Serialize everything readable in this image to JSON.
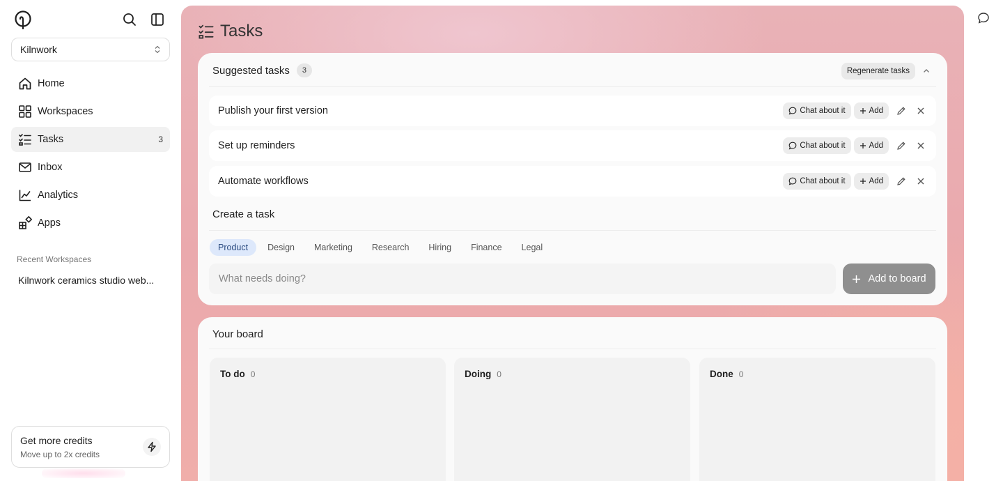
{
  "sidebar": {
    "workspace_name": "Kilnwork",
    "nav": [
      {
        "label": "Home",
        "icon": "home-icon"
      },
      {
        "label": "Workspaces",
        "icon": "grid-icon"
      },
      {
        "label": "Tasks",
        "icon": "tasks-icon",
        "count": "3",
        "active": true
      },
      {
        "label": "Inbox",
        "icon": "mail-icon"
      },
      {
        "label": "Analytics",
        "icon": "chart-icon"
      },
      {
        "label": "Apps",
        "icon": "apps-icon"
      }
    ],
    "recent_label": "Recent Workspaces",
    "recent_items": [
      "Kilnwork ceramics studio web..."
    ],
    "credits": {
      "title": "Get more credits",
      "subtitle": "Move up to 2x credits"
    }
  },
  "page": {
    "title": "Tasks"
  },
  "suggested": {
    "title": "Suggested tasks",
    "count": "3",
    "regenerate_label": "Regenerate tasks",
    "chat_label": "Chat about it",
    "add_label": "Add",
    "tasks": [
      "Publish your first version",
      "Set up reminders",
      "Automate workflows"
    ]
  },
  "create": {
    "title": "Create a task",
    "categories": [
      "Product",
      "Design",
      "Marketing",
      "Research",
      "Hiring",
      "Finance",
      "Legal"
    ],
    "active_category": "Product",
    "placeholder": "What needs doing?",
    "submit_label": "Add to board"
  },
  "board": {
    "title": "Your board",
    "columns": [
      {
        "name": "To do",
        "count": "0"
      },
      {
        "name": "Doing",
        "count": "0"
      },
      {
        "name": "Done",
        "count": "0"
      }
    ]
  },
  "colors": {
    "accent_pill": "#dde8fb",
    "submit_button": "#8f8f8f",
    "main_gradient_start": "#e9b2b7",
    "main_gradient_end": "#f0aeaa"
  }
}
